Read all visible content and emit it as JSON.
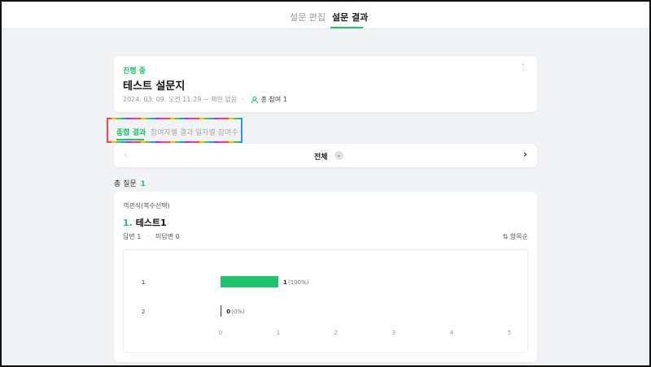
{
  "header": {
    "tabs": [
      {
        "label": "설문 편집",
        "active": false
      },
      {
        "label": "설문 결과",
        "active": true
      }
    ]
  },
  "survey": {
    "status": "진행 중",
    "title": "테스트 설문지",
    "date_text": "2024. 03. 09. 오전 11:29 ~ 제한 없음",
    "participants_label": "총 참여 1"
  },
  "subtabs": [
    {
      "label": "종합 결과",
      "active": true
    },
    {
      "label": "참여자별 결과",
      "active": false
    },
    {
      "label": "일자별 참여수",
      "active": false
    }
  ],
  "filter": {
    "label": "전체"
  },
  "total_questions": {
    "label": "총 질문",
    "count": "1"
  },
  "question": {
    "type": "객관식(복수선택)",
    "number": "1.",
    "title": "테스트1",
    "answered": "답변 1",
    "unanswered": "미답변 0",
    "sort_label": "항목순"
  },
  "colors": {
    "accent": "#1fc36a",
    "bar": "#1fc36a",
    "zero_bar": "#3b4aa8"
  },
  "chart_data": {
    "type": "bar",
    "orientation": "horizontal",
    "categories": [
      "1",
      "2"
    ],
    "values": [
      1,
      0
    ],
    "value_labels": [
      "1",
      "0"
    ],
    "percent_labels": [
      "(100%)",
      "(0%)"
    ],
    "xlim": [
      0,
      5
    ],
    "xticks": [
      "0",
      "1",
      "2",
      "3",
      "4",
      "5"
    ],
    "grid": false
  }
}
